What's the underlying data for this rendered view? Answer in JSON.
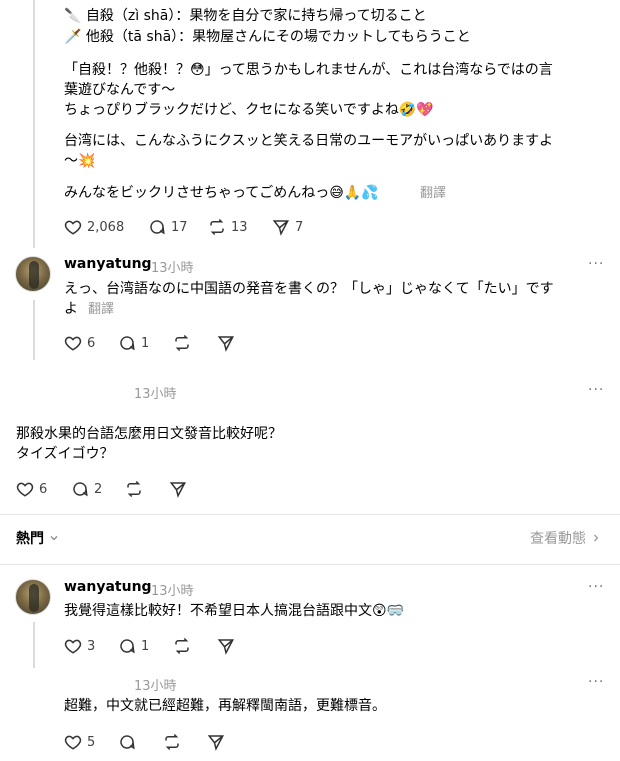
{
  "post": {
    "lines": [
      "🔪 自殺（zì shā）：果物を自分で家に持ち帰って切ること",
      "🗡️ 他殺（tā shā）：果物屋さんにその場でカットしてもらうこと",
      "「自殺！？他殺！？😳」って思うかもしれませんが、これは台湾ならではの言",
      "葉遊びなんです～",
      "ちょっぴりブラックだけど、クセになる笑いですよね🤣💖",
      "台湾には、こんなふうにクスッと笑える日常のユーモアがいっぱいありますよ",
      "～💥",
      "みんなをビックリさせちゃってごめんねっ😅🙏💦"
    ],
    "translate": "翻譯",
    "likes": "2,068",
    "comments": "17",
    "reposts": "13",
    "shares": "7"
  },
  "reply1": {
    "user": "wanyatung",
    "time": "13小時",
    "more": "···",
    "line1": "えっ、台湾語なのに中国語の発音を書くの？「しゃ」じゃなくて「たい」です",
    "line2": "よ",
    "translate": "翻譯",
    "likes": "6",
    "comments": "1"
  },
  "reply2": {
    "time": "13小時",
    "more": "···",
    "line1": "那殺水果的台語怎麼用日文發音比較好呢？",
    "line2": "タイズイゴウ？",
    "likes": "6",
    "comments": "2"
  },
  "sort": {
    "label": "熱門",
    "view_activity": "查看動態"
  },
  "reply3": {
    "user": "wanyatung",
    "time": "13小時",
    "more": "···",
    "text": "我覺得這樣比較好！不希望日本人搞混台語跟中文😲🥽",
    "likes": "3",
    "comments": "1"
  },
  "reply4": {
    "time": "13小時",
    "more": "···",
    "text": "超難，中文就已經超難，再解釋閩南語，更難標音。",
    "likes": "5"
  }
}
